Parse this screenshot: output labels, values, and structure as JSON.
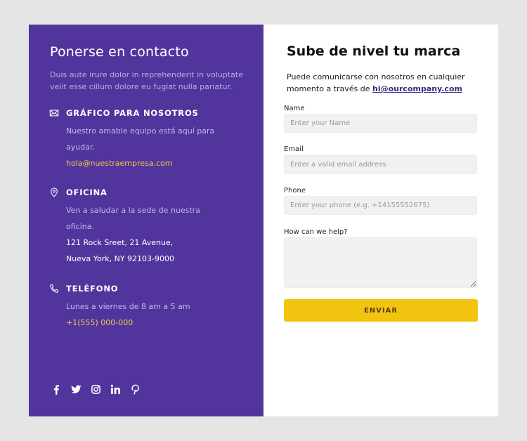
{
  "left": {
    "title": "Ponerse en contacto",
    "intro": "Duis aute irure dolor in reprehenderit in voluptate velit esse cillum dolore eu fugiat nulla pariatur.",
    "sections": [
      {
        "icon": "mail-icon",
        "title": "GRÁFICO PARA NOSOTROS",
        "lines": [
          "Nuestro amable equipo está aquí para",
          "ayudar."
        ],
        "link": "hola@nuestraempresa.com"
      },
      {
        "icon": "map-pin-icon",
        "title": "OFICINA",
        "lines": [
          "Ven a saludar a la sede de nuestra",
          "oficina."
        ],
        "address": [
          "121 Rock Sreet, 21 Avenue,",
          "Nueva York, NY 92103-9000"
        ]
      },
      {
        "icon": "phone-icon",
        "title": "TELÉFONO",
        "lines": [
          "Lunes a viernes de 8 am a 5 am"
        ],
        "link": "+1(555) 000-000"
      }
    ],
    "social": [
      "facebook-icon",
      "twitter-icon",
      "instagram-icon",
      "linkedin-icon",
      "pinterest-icon"
    ]
  },
  "right": {
    "title": "Sube de nivel tu marca",
    "intro": "Puede comunicarse con nosotros en cualquier momento a través de",
    "email": "hi@ourcompany.com",
    "fields": {
      "name": {
        "label": "Name",
        "placeholder": "Enter your Name",
        "value": ""
      },
      "email": {
        "label": "Email",
        "placeholder": "Enter a valid email address",
        "value": ""
      },
      "phone": {
        "label": "Phone",
        "placeholder": "Enter your phone (e.g. +14155552675)",
        "value": ""
      },
      "message": {
        "label": "How can we help?",
        "placeholder": "",
        "value": ""
      }
    },
    "submit_label": "ENVIAR"
  },
  "colors": {
    "panel": "#51359d",
    "accent": "#f2c94c",
    "button": "#f1c40f",
    "background": "#e5e5e5"
  }
}
